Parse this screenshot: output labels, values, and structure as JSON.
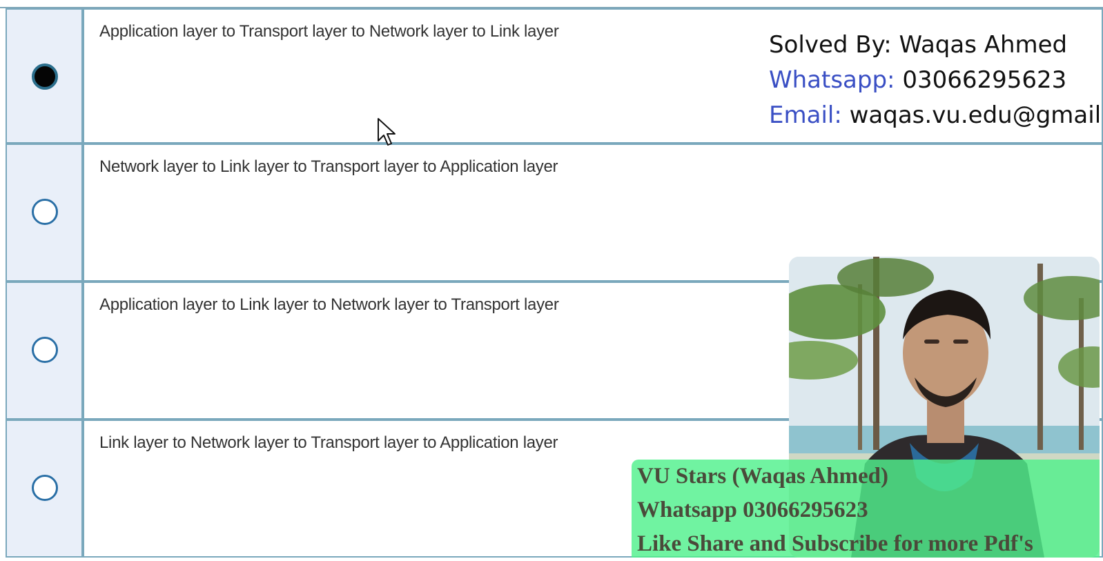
{
  "question": {
    "options": [
      {
        "label": "Application layer to Transport layer to Network layer to Link layer",
        "selected": true
      },
      {
        "label": "Network layer to Link layer to Transport layer to Application layer",
        "selected": false
      },
      {
        "label": "Application layer to Link layer to Network layer to Transport layer",
        "selected": false
      },
      {
        "label": "Link layer to Network layer to Transport layer to Application layer",
        "selected": false
      }
    ]
  },
  "overlay": {
    "solved_by": "Solved By: Waqas Ahmed",
    "whatsapp_key": "Whatsapp:",
    "whatsapp_value": "03066295623",
    "email_key": "Email:",
    "email_value": "waqas.vu.edu@gmail"
  },
  "banner": {
    "line1": "VU Stars (Waqas Ahmed)",
    "line2": "Whatsapp 03066295623",
    "line3": "Like Share and Subscribe for more Pdf's"
  },
  "colors": {
    "row_border": "#7aa8bc",
    "radio_cell_bg": "#e9eff9",
    "overlay_key": "#3a4fc4",
    "banner_bg": "#50f08c"
  }
}
